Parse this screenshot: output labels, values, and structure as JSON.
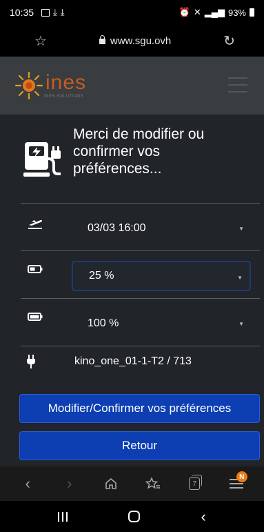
{
  "status_bar": {
    "time": "10:35",
    "right_text": "93%",
    "signal_label": "4G",
    "battery_label": "■"
  },
  "browser": {
    "url": "www.sgu.ovh",
    "tab_count": "7",
    "menu_badge": "N"
  },
  "site": {
    "logo_text": "ines",
    "logo_subtitle": "INES SOLUTIONS",
    "colors": {
      "header_bg": "#3a3d40",
      "logo": "#c85a22",
      "page_bg": "#212529",
      "button": "#0d3fb2"
    }
  },
  "main": {
    "intro_text": "Merci de modifier ou confirmer vos préférences...",
    "departure": {
      "icon": "airplane-departure-icon",
      "value": "03/03 16:00"
    },
    "min_charge": {
      "icon": "battery-low-icon",
      "value": "25 %"
    },
    "target_charge": {
      "icon": "battery-full-icon",
      "value": "100 %"
    },
    "charger": {
      "icon": "plug-icon",
      "value": "kino_one_01-1-T2 / 713"
    },
    "confirm_button": "Modifier/Confirmer vos préférences",
    "back_button": "Retour"
  }
}
